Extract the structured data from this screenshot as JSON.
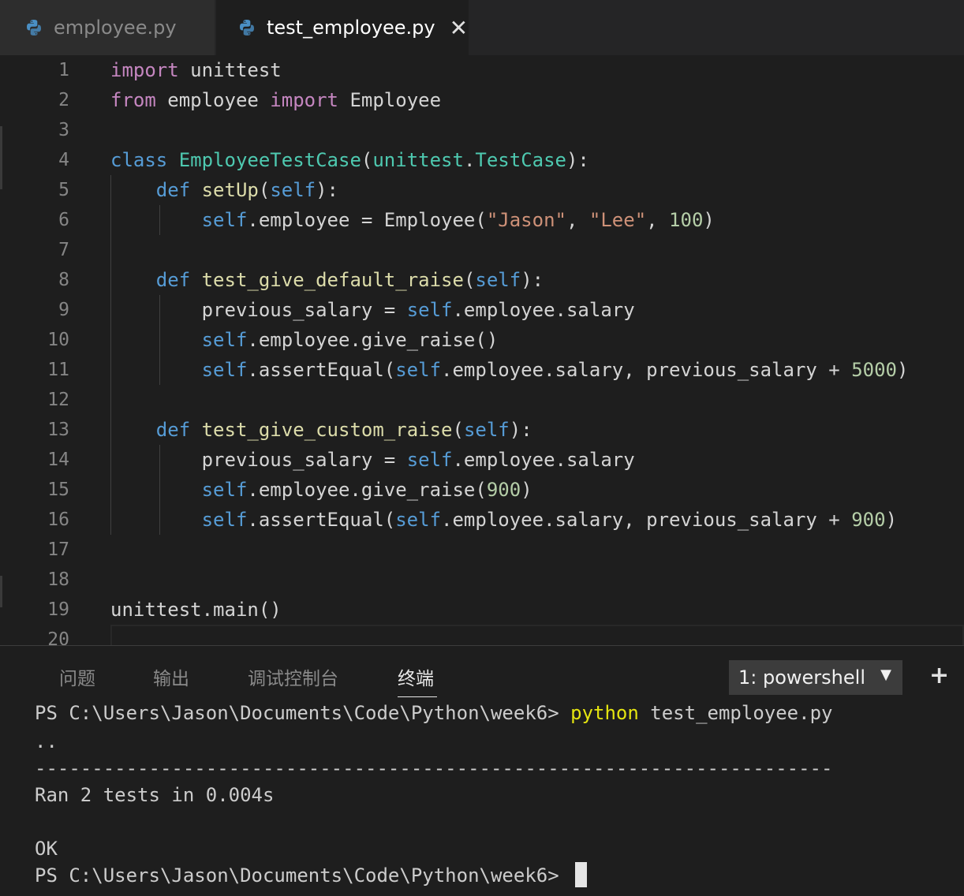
{
  "tabs": [
    {
      "label": "employee.py",
      "active": false
    },
    {
      "label": "test_employee.py",
      "active": true,
      "close": "✕"
    }
  ],
  "editor": {
    "line_numbers": [
      "1",
      "2",
      "3",
      "4",
      "5",
      "6",
      "7",
      "8",
      "9",
      "10",
      "11",
      "12",
      "13",
      "14",
      "15",
      "16",
      "17",
      "18",
      "19",
      "20"
    ],
    "lines": [
      "import unittest",
      "from employee import Employee",
      "",
      "class EmployeeTestCase(unittest.TestCase):",
      "    def setUp(self):",
      "        self.employee = Employee(\"Jason\", \"Lee\", 100)",
      "",
      "    def test_give_default_raise(self):",
      "        previous_salary = self.employee.salary",
      "        self.employee.give_raise()",
      "        self.assertEqual(self.employee.salary, previous_salary + 5000)",
      "",
      "    def test_give_custom_raise(self):",
      "        previous_salary = self.employee.salary",
      "        self.employee.give_raise(900)",
      "        self.assertEqual(self.employee.salary, previous_salary + 900)",
      "",
      "",
      "unittest.main()",
      ""
    ]
  },
  "panel": {
    "tabs": [
      "问题",
      "输出",
      "调试控制台",
      "终端"
    ],
    "active_tab": "终端",
    "terminal_select": "1: powershell",
    "add_label": "+"
  },
  "terminal": {
    "prompt": "PS C:\\Users\\Jason\\Documents\\Code\\Python\\week6> ",
    "command": "python",
    "command_args": " test_employee.py",
    "dots": "..",
    "separator": "----------------------------------------------------------------------",
    "ran": "Ran 2 tests in 0.004s",
    "ok": "OK",
    "prompt2": "PS C:\\Users\\Jason\\Documents\\Code\\Python\\week6> "
  },
  "colors": {
    "keyword": "#c586c0",
    "storage": "#569cd6",
    "function": "#dcdcaa",
    "class": "#4ec9b0",
    "string": "#ce9178",
    "number": "#b5cea8",
    "terminal_command": "#e5e510"
  }
}
